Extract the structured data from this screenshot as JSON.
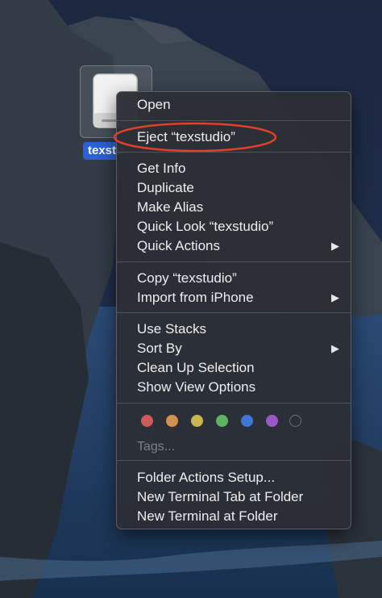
{
  "desktop": {
    "volume_label": "texstudio"
  },
  "context_menu": {
    "groups": [
      {
        "items": [
          {
            "label": "Open",
            "submenu": false
          }
        ]
      },
      {
        "items": [
          {
            "label": "Eject “texstudio”",
            "submenu": false
          }
        ]
      },
      {
        "items": [
          {
            "label": "Get Info",
            "submenu": false
          },
          {
            "label": "Duplicate",
            "submenu": false
          },
          {
            "label": "Make Alias",
            "submenu": false
          },
          {
            "label": "Quick Look “texstudio”",
            "submenu": false
          },
          {
            "label": "Quick Actions",
            "submenu": true
          }
        ]
      },
      {
        "items": [
          {
            "label": "Copy “texstudio”",
            "submenu": false
          },
          {
            "label": "Import from iPhone",
            "submenu": true
          }
        ]
      },
      {
        "items": [
          {
            "label": "Use Stacks",
            "submenu": false
          },
          {
            "label": "Sort By",
            "submenu": true
          },
          {
            "label": "Clean Up Selection",
            "submenu": false
          },
          {
            "label": "Show View Options",
            "submenu": false
          }
        ]
      },
      {
        "items": [
          {
            "label": "Folder Actions Setup...",
            "submenu": false
          },
          {
            "label": "New Terminal Tab at Folder",
            "submenu": false
          },
          {
            "label": "New Terminal at Folder",
            "submenu": false
          }
        ]
      }
    ],
    "submenu_glyph": "▶",
    "tags": {
      "label": "Tags...",
      "colors": [
        {
          "name": "red",
          "hex": "#d05a5a"
        },
        {
          "name": "orange",
          "hex": "#cf9252"
        },
        {
          "name": "yellow",
          "hex": "#cbb64c"
        },
        {
          "name": "green",
          "hex": "#5fb365"
        },
        {
          "name": "blue",
          "hex": "#3f77d6"
        },
        {
          "name": "purple",
          "hex": "#9a5ac6"
        },
        {
          "name": "gray",
          "hex": "#3a3d44"
        }
      ]
    }
  },
  "annotation": {
    "highlight_color": "#e2402d"
  }
}
